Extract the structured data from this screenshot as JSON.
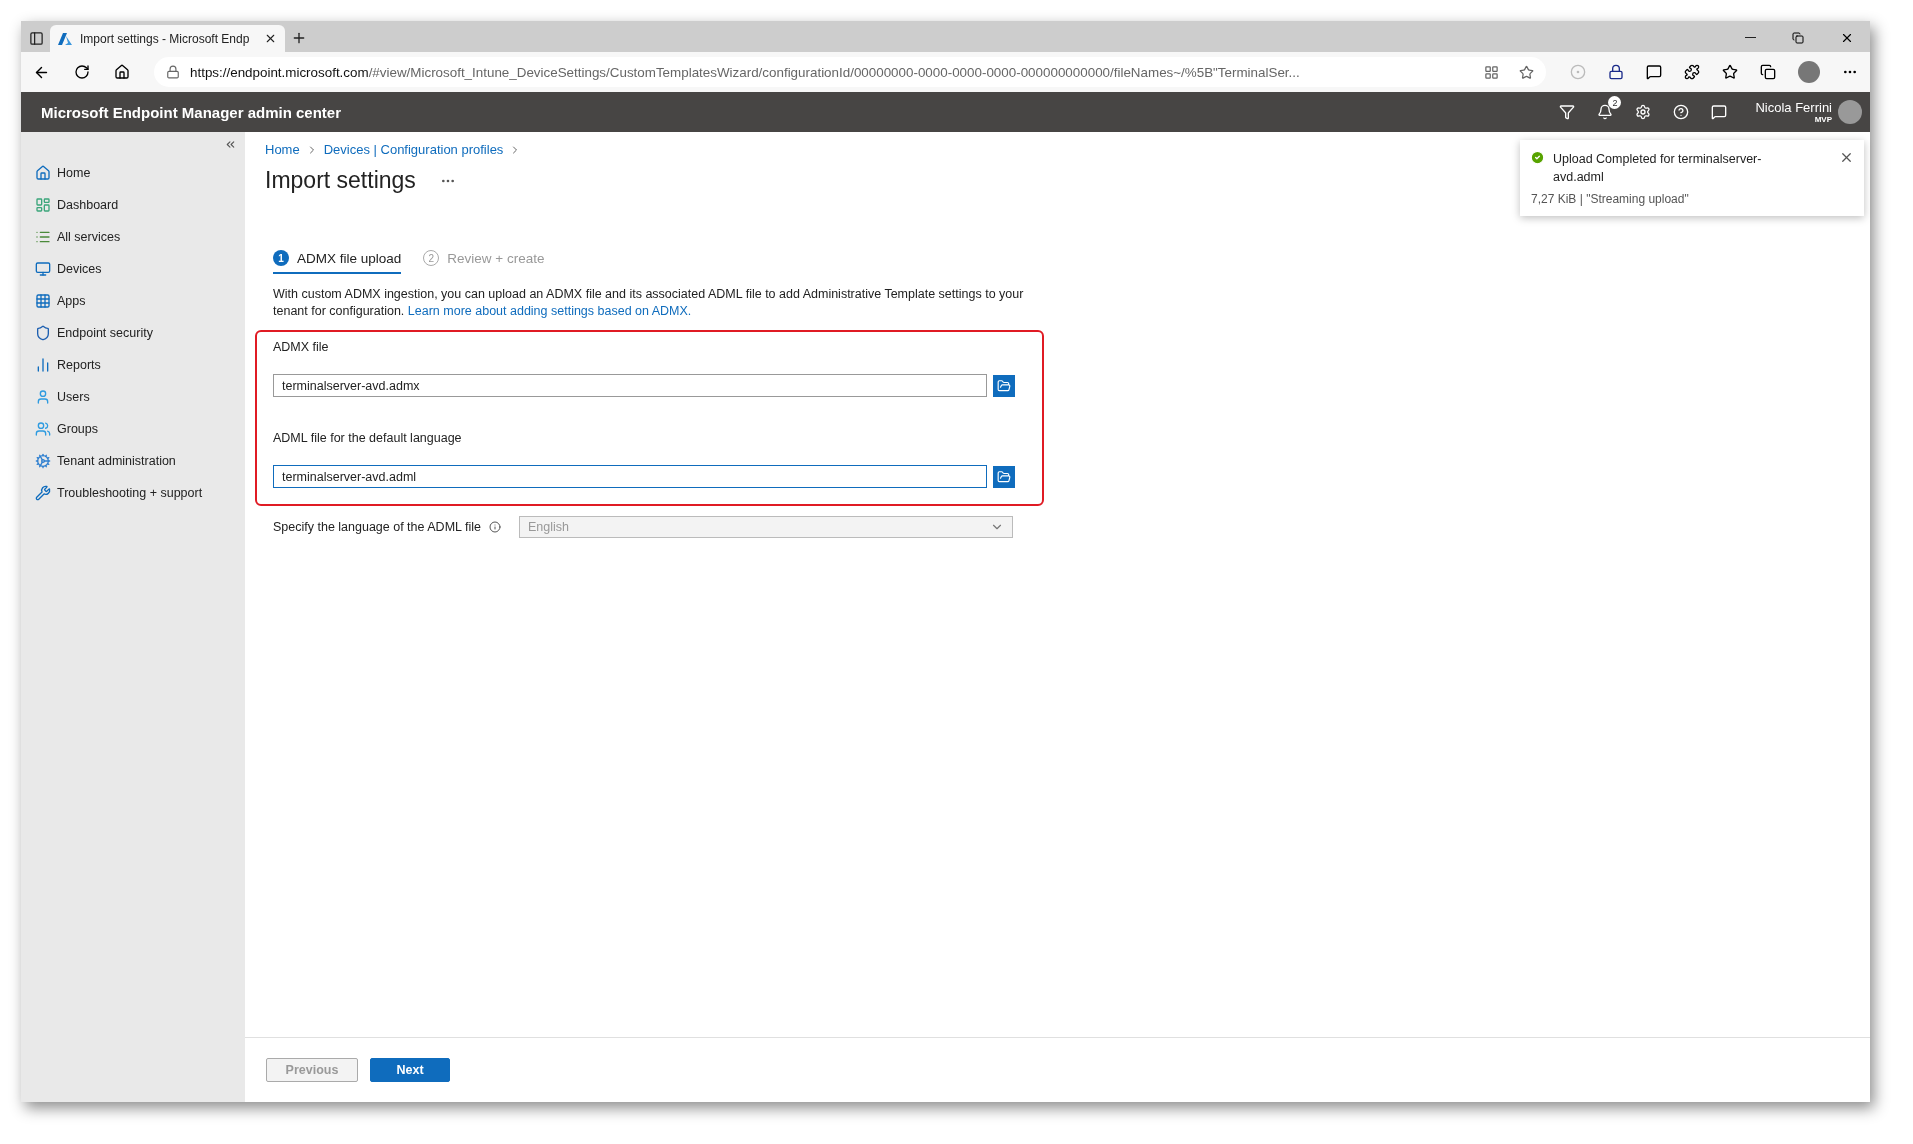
{
  "browser": {
    "tab_title": "Import settings - Microsoft Endp",
    "url_host": "https://endpoint.microsoft.com",
    "url_path": "/#view/Microsoft_Intune_DeviceSettings/CustomTemplatesWizard/configurationId/00000000-0000-0000-0000-000000000000/fileNames~/%5B\"TerminalSer..."
  },
  "portal_header": {
    "title": "Microsoft Endpoint Manager admin center",
    "notification_count": "2",
    "user_name": "Nicola Ferrini",
    "user_badge": "MVP"
  },
  "sidebar": {
    "items": [
      {
        "label": "Home",
        "kind": "home"
      },
      {
        "label": "Dashboard",
        "kind": "dashboard"
      },
      {
        "label": "All services",
        "kind": "list"
      },
      {
        "label": "Devices",
        "kind": "devices"
      },
      {
        "label": "Apps",
        "kind": "apps"
      },
      {
        "label": "Endpoint security",
        "kind": "shield"
      },
      {
        "label": "Reports",
        "kind": "reports"
      },
      {
        "label": "Users",
        "kind": "user"
      },
      {
        "label": "Groups",
        "kind": "users"
      },
      {
        "label": "Tenant administration",
        "kind": "tenant"
      },
      {
        "label": "Troubleshooting + support",
        "kind": "tools"
      }
    ]
  },
  "breadcrumb": [
    "Home",
    "Devices | Configuration profiles"
  ],
  "page_title": "Import settings",
  "steps": [
    {
      "number": "1",
      "label": "ADMX file upload",
      "selected": true
    },
    {
      "number": "2",
      "label": "Review + create",
      "selected": false
    }
  ],
  "description": {
    "text": "With custom ADMX ingestion, you can upload an ADMX file and its associated ADML file to add Administrative Template settings to your tenant for configuration.",
    "link": "Learn more about adding settings based on ADMX."
  },
  "file_fields": [
    {
      "label": "ADMX file",
      "value": "terminalserver-avd.admx",
      "focused": false
    },
    {
      "label": "ADML file for the default language",
      "value": "terminalserver-avd.adml",
      "focused": true
    }
  ],
  "language": {
    "label": "Specify the language of the ADML file",
    "value": "English",
    "disabled": true
  },
  "toast": {
    "title": "Upload Completed for terminalserver-avd.adml",
    "detail": "7,27 KiB | \"Streaming upload\""
  },
  "buttons": [
    {
      "label": "Previous",
      "disabled": true
    },
    {
      "label": "Next",
      "disabled": false
    }
  ]
}
